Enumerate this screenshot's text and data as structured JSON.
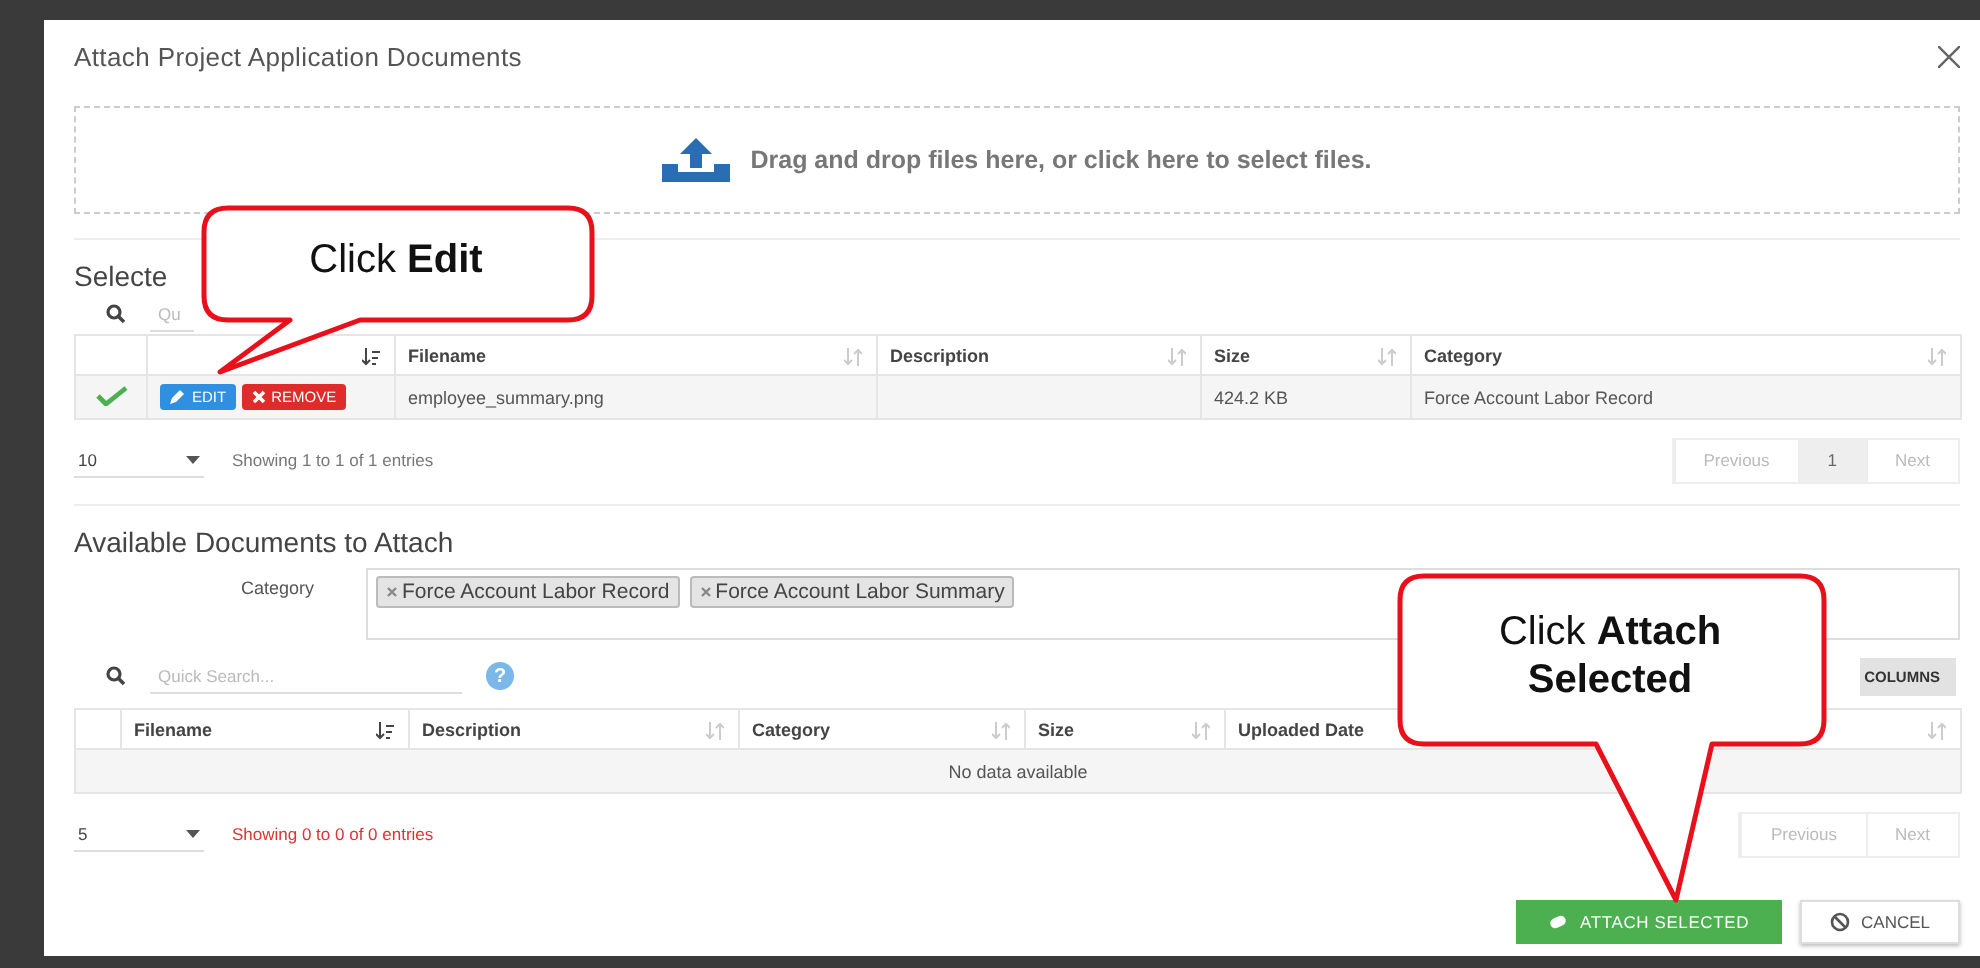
{
  "dialog": {
    "title": "Attach Project Application Documents"
  },
  "dropzone": {
    "text": "Drag and drop files here, or click here to select files."
  },
  "selected": {
    "heading": "Selecte",
    "search_placeholder": "Qu",
    "columns": [
      {
        "sorted": true
      },
      {
        "label": "Filename",
        "sorted": false
      },
      {
        "label": "Description",
        "sorted": false
      },
      {
        "label": "Size",
        "sorted": false
      },
      {
        "label": "Category",
        "sorted": false
      }
    ],
    "rows": [
      {
        "checked": true,
        "edit": "EDIT",
        "remove": "REMOVE",
        "filename": "employee_summary.png",
        "size": "424.2 KB",
        "category": "Force Account Labor Record"
      }
    ],
    "pager": {
      "page_size": "10",
      "info": "Showing 1 to 1 of 1 entries",
      "alert": false,
      "previous": "Previous",
      "pages": [
        {
          "label": "1",
          "selected": true
        }
      ],
      "next": "Next"
    }
  },
  "available": {
    "heading": "Available Documents to Attach",
    "category_label": "Category",
    "tags": [
      "Force Account Labor Record",
      "Force Account Labor Summary"
    ],
    "search_placeholder": "Quick Search...",
    "help_icon": "?",
    "columns_button": "COLUMNS",
    "columns": [
      {
        "label": "Filename",
        "sorted": true
      },
      {
        "label": "Description",
        "sorted": false
      },
      {
        "label": "Category",
        "sorted": false
      },
      {
        "label": "Size",
        "sorted": false
      },
      {
        "label": "Uploaded Date"
      },
      {
        "sorted": false
      }
    ],
    "empty_text": "No data available",
    "pager": {
      "page_size": "5",
      "info": "Showing 0 to 0 of 0 entries",
      "alert": true,
      "previous": "Previous",
      "next": "Next"
    }
  },
  "buttons": {
    "attach": "ATTACH SELECTED",
    "cancel": "CANCEL"
  },
  "callouts": [
    {
      "text": "Click **Edit**"
    },
    {
      "text": "Click **Attach Selected**"
    }
  ]
}
